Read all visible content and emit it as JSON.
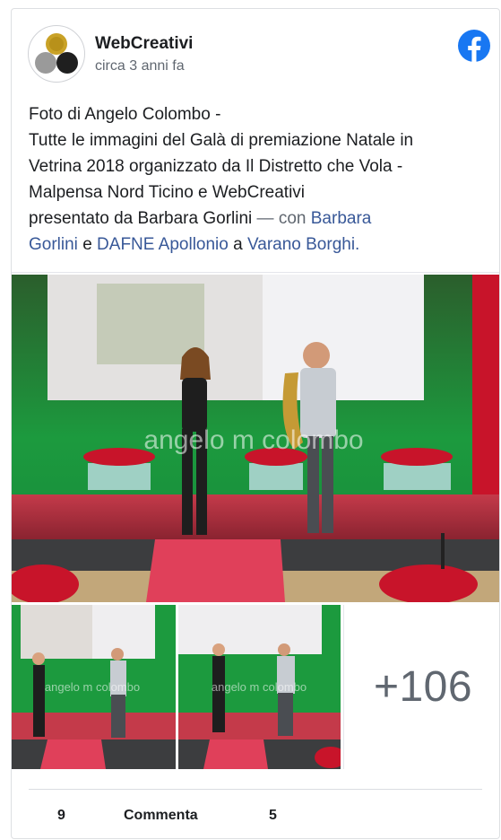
{
  "post": {
    "author": "WebCreativi",
    "timestamp": "circa 3 anni fa",
    "text_lines": [
      "Foto di Angelo Colombo -",
      "Tutte le immagini del Galà di premiazione Natale in",
      "Vetrina 2018 organizzato da Il Distretto che Vola -",
      "Malpensa Nord Ticino e WebCreativi"
    ],
    "presenter": "presentato da Barbara Gorlini",
    "with_text": "— con",
    "tag_person_1": "Barbara Gorlini",
    "conj_e": "e",
    "tag_person_2": "DAFNE Apollonio",
    "conj_a": "a",
    "tag_place": "Varano Borghi.",
    "tag_person_1_line1": "Barbara",
    "tag_person_1_line2": "Gorlini"
  },
  "photos": {
    "watermark": "angelo m colombo",
    "more_count": "+106"
  },
  "footer": {
    "likes": "9",
    "comments_label": "Commenta",
    "shares": "5"
  },
  "colors": {
    "link": "#385898",
    "facebook_blue": "#1877f2",
    "secondary_text": "#606770",
    "stage_green": "#1f8a3a",
    "carpet_red": "#e0405a"
  },
  "icons": {
    "brand": "facebook-icon",
    "avatar": "webcreativi-logo"
  }
}
